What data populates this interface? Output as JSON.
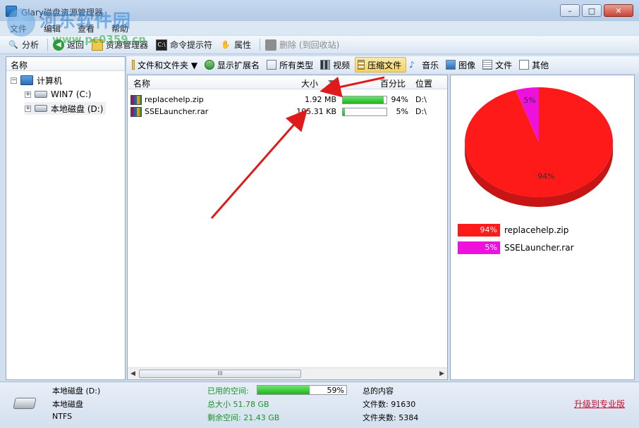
{
  "window": {
    "title": "Glary磁盘资源管理器",
    "buttons": [
      "–",
      "□",
      "✕"
    ]
  },
  "watermark": {
    "text": "河东软件园",
    "url": "www.pc0359.cn"
  },
  "menu": {
    "items": [
      "文件",
      "编辑",
      "查看",
      "帮助"
    ]
  },
  "toolbar": {
    "analyze": "分析",
    "back": "返回",
    "explorer": "资源管理器",
    "cmd": "命令提示符",
    "properties": "属性",
    "delete": "删除 (到回收站)"
  },
  "tree": {
    "header": "名称",
    "root": "计算机",
    "items": [
      {
        "label": "WIN7 (C:)"
      },
      {
        "label": "本地磁盘 (D:)"
      }
    ]
  },
  "filter_bar": {
    "files_and_folders": "文件和文件夹 ▼",
    "show_ext": "显示扩展名",
    "all_types": "所有类型",
    "video": "视频",
    "compressed": "压缩文件",
    "music": "音乐",
    "image": "图像",
    "document": "文件",
    "other": "其他"
  },
  "file_list": {
    "columns": {
      "name": "名称",
      "size": "大小",
      "percent": "百分比",
      "location": "位置"
    },
    "rows": [
      {
        "name": "replacehelp.zip",
        "size": "1.92 MB",
        "percent_text": "94%",
        "percent": 94,
        "location": "D:\\"
      },
      {
        "name": "SSELauncher.rar",
        "size": "105.31 KB",
        "percent_text": "5%",
        "percent": 5,
        "location": "D:\\"
      }
    ],
    "scroll_thumb": "III"
  },
  "chart_data": {
    "type": "pie",
    "labels": [
      "replacehelp.zip",
      "SSELauncher.rar"
    ],
    "values": [
      94,
      5
    ],
    "value_labels": [
      "94%",
      "5%"
    ],
    "colors": [
      "#ff1a1a",
      "#ee11dd"
    ]
  },
  "status": {
    "drive_name": "本地磁盘 (D:)",
    "drive_label": "本地磁盘",
    "fs": "NTFS",
    "used_label": "已用的空间:",
    "used_percent_text": "59%",
    "used_percent": 59,
    "total_size": "总大小 51.78 GB",
    "free_space": "剩余空间: 21.43 GB",
    "contents_label": "总的内容",
    "file_count": "文件数: 91630",
    "folder_count": "文件夹数: 5384",
    "upgrade": "升级到专业版"
  },
  "colors": {
    "accent": "#1fb41c",
    "link": "#c8102e",
    "highlight": "#f3d26a"
  }
}
